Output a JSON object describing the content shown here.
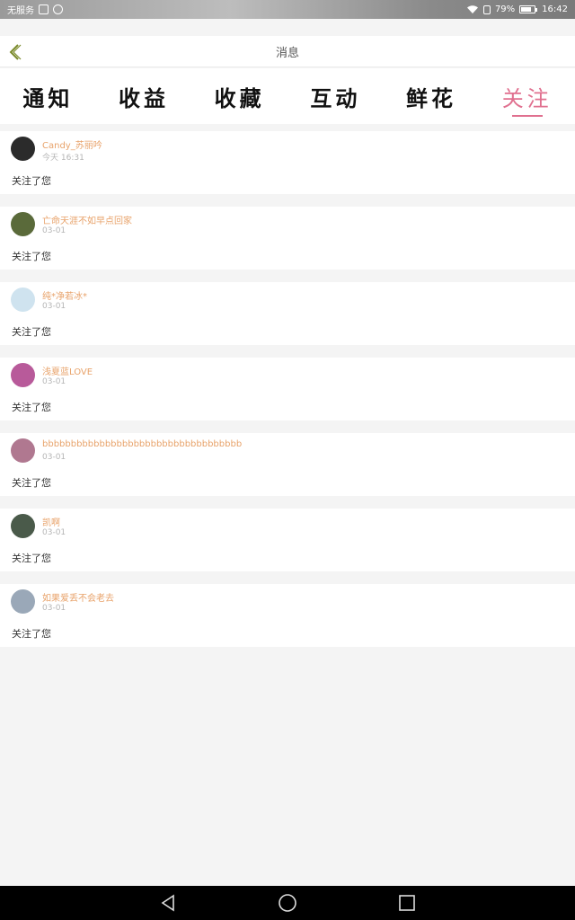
{
  "status_bar": {
    "carrier": "无服务",
    "battery": "79%",
    "battery_level": 0.79,
    "time": "16:42"
  },
  "header": {
    "title": "消息"
  },
  "tabs": [
    {
      "label": "通知",
      "active": false
    },
    {
      "label": "收益",
      "active": false
    },
    {
      "label": "收藏",
      "active": false
    },
    {
      "label": "互动",
      "active": false
    },
    {
      "label": "鲜花",
      "active": false
    },
    {
      "label": "关注",
      "active": true
    }
  ],
  "items": [
    {
      "name": "Candy_苏丽吟",
      "time": "今天 16:31",
      "message": "关注了您",
      "avatar_color": "#2b2b2b"
    },
    {
      "name": "亡命天涯不如早点回家",
      "time": "03-01",
      "message": "关注了您",
      "avatar_color": "#5a6a3a"
    },
    {
      "name": "纯*净若冰*",
      "time": "03-01",
      "message": "关注了您",
      "avatar_color": "#cfe3ef"
    },
    {
      "name": "浅夏蓝LOVE",
      "time": "03-01",
      "message": "关注了您",
      "avatar_color": "#b85a9a"
    },
    {
      "name": "bbbbbbbbbbbbbbbbbbbbbbbbbbbbbbbbbbb",
      "time": "03-01",
      "message": "关注了您",
      "avatar_color": "#b07890"
    },
    {
      "name": "凯啊",
      "time": "03-01",
      "message": "关注了您",
      "avatar_color": "#4a5a4a"
    },
    {
      "name": "如果爱丢不会老去",
      "time": "03-01",
      "message": "关注了您",
      "avatar_color": "#9aa8b8"
    }
  ],
  "accent_color": "#e0708f",
  "name_color": "#e8a36b"
}
